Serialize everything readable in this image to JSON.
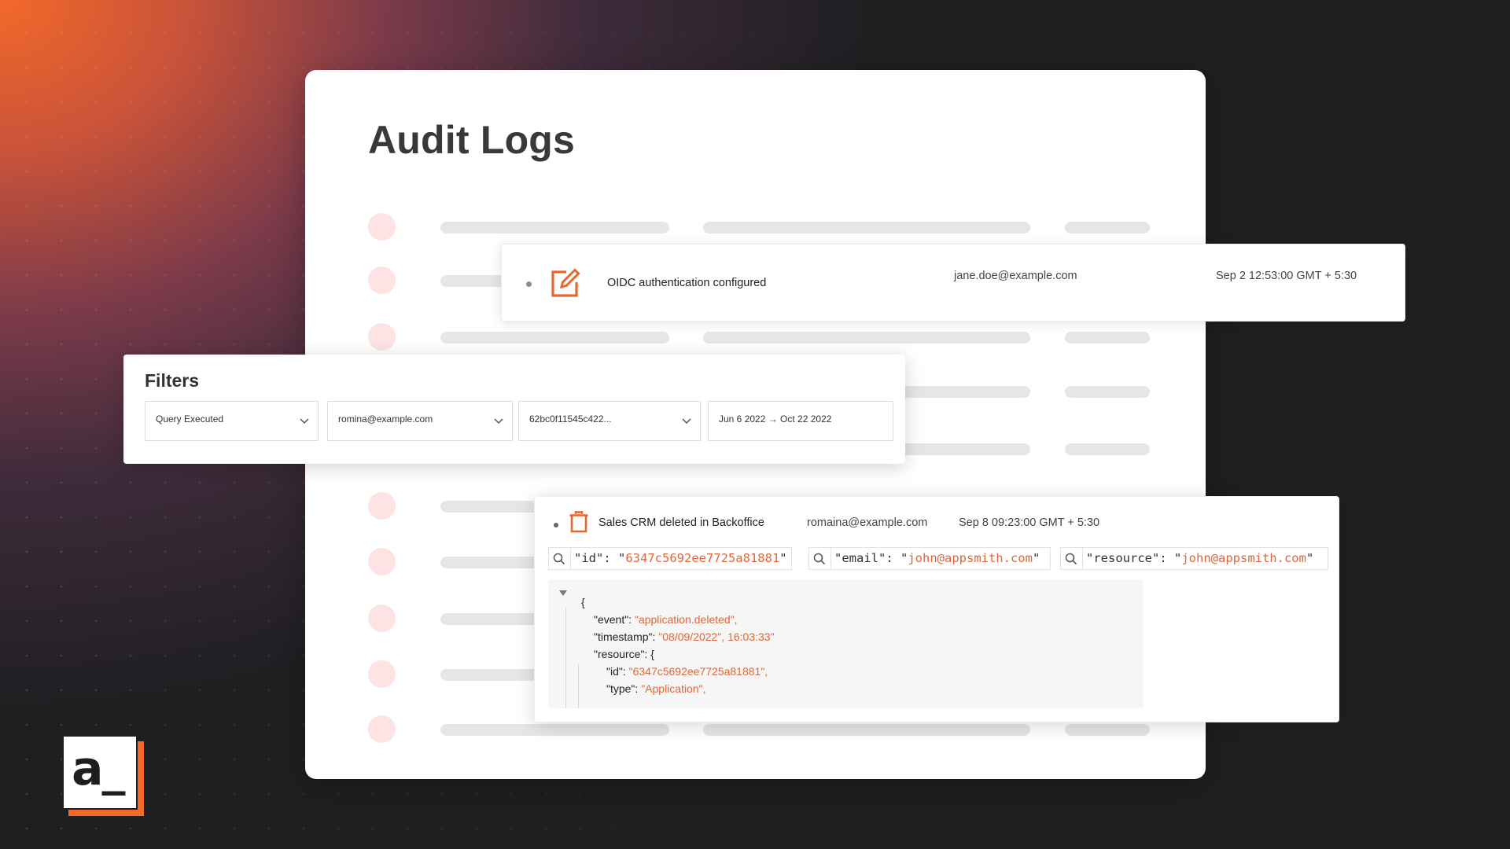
{
  "page": {
    "title": "Audit Logs"
  },
  "featured_event": {
    "event": "OIDC authentication configured",
    "user": "jane.doe@example.com",
    "time": "Sep 2 12:53:00 GMT + 5:30"
  },
  "filters": {
    "title": "Filters",
    "items": [
      {
        "value": "Query Executed"
      },
      {
        "value": "romina@example.com"
      },
      {
        "value": "62bc0f11545c422..."
      },
      {
        "value": "Jun 6 2022 → Oct 22 2022"
      }
    ]
  },
  "detail": {
    "event": "Sales CRM deleted in Backoffice",
    "user": "romaina@example.com",
    "time": "Sep 8 09:23:00 GMT + 5:30",
    "search_chips": [
      {
        "key": "\"id\": \"",
        "value": "6347c5692ee7725a81881",
        "close": "\""
      },
      {
        "key": "\"email\": \"",
        "value": "john@appsmith.com",
        "close": "\""
      },
      {
        "key": "\"resource\": \"",
        "value": "john@appsmith.com",
        "close": "\""
      }
    ],
    "json": {
      "open": "{",
      "event_key": "\"event\": ",
      "event_val": "\"application.deleted\",",
      "timestamp_key": "\"timestamp\": ",
      "timestamp_val": "\"08/09/2022\", 16:03:33\"",
      "resource_key": "\"resource\": {",
      "id_key": "\"id\": ",
      "id_val": "\"6347c5692ee7725a81881\",",
      "type_key": "\"type\": ",
      "type_val": "\"Application\","
    }
  },
  "logo": {
    "text": "a_"
  },
  "colors": {
    "accent": "#e0663a",
    "skeleton_dot": "#fde3e3",
    "skeleton_bar": "#e6e6e6"
  }
}
